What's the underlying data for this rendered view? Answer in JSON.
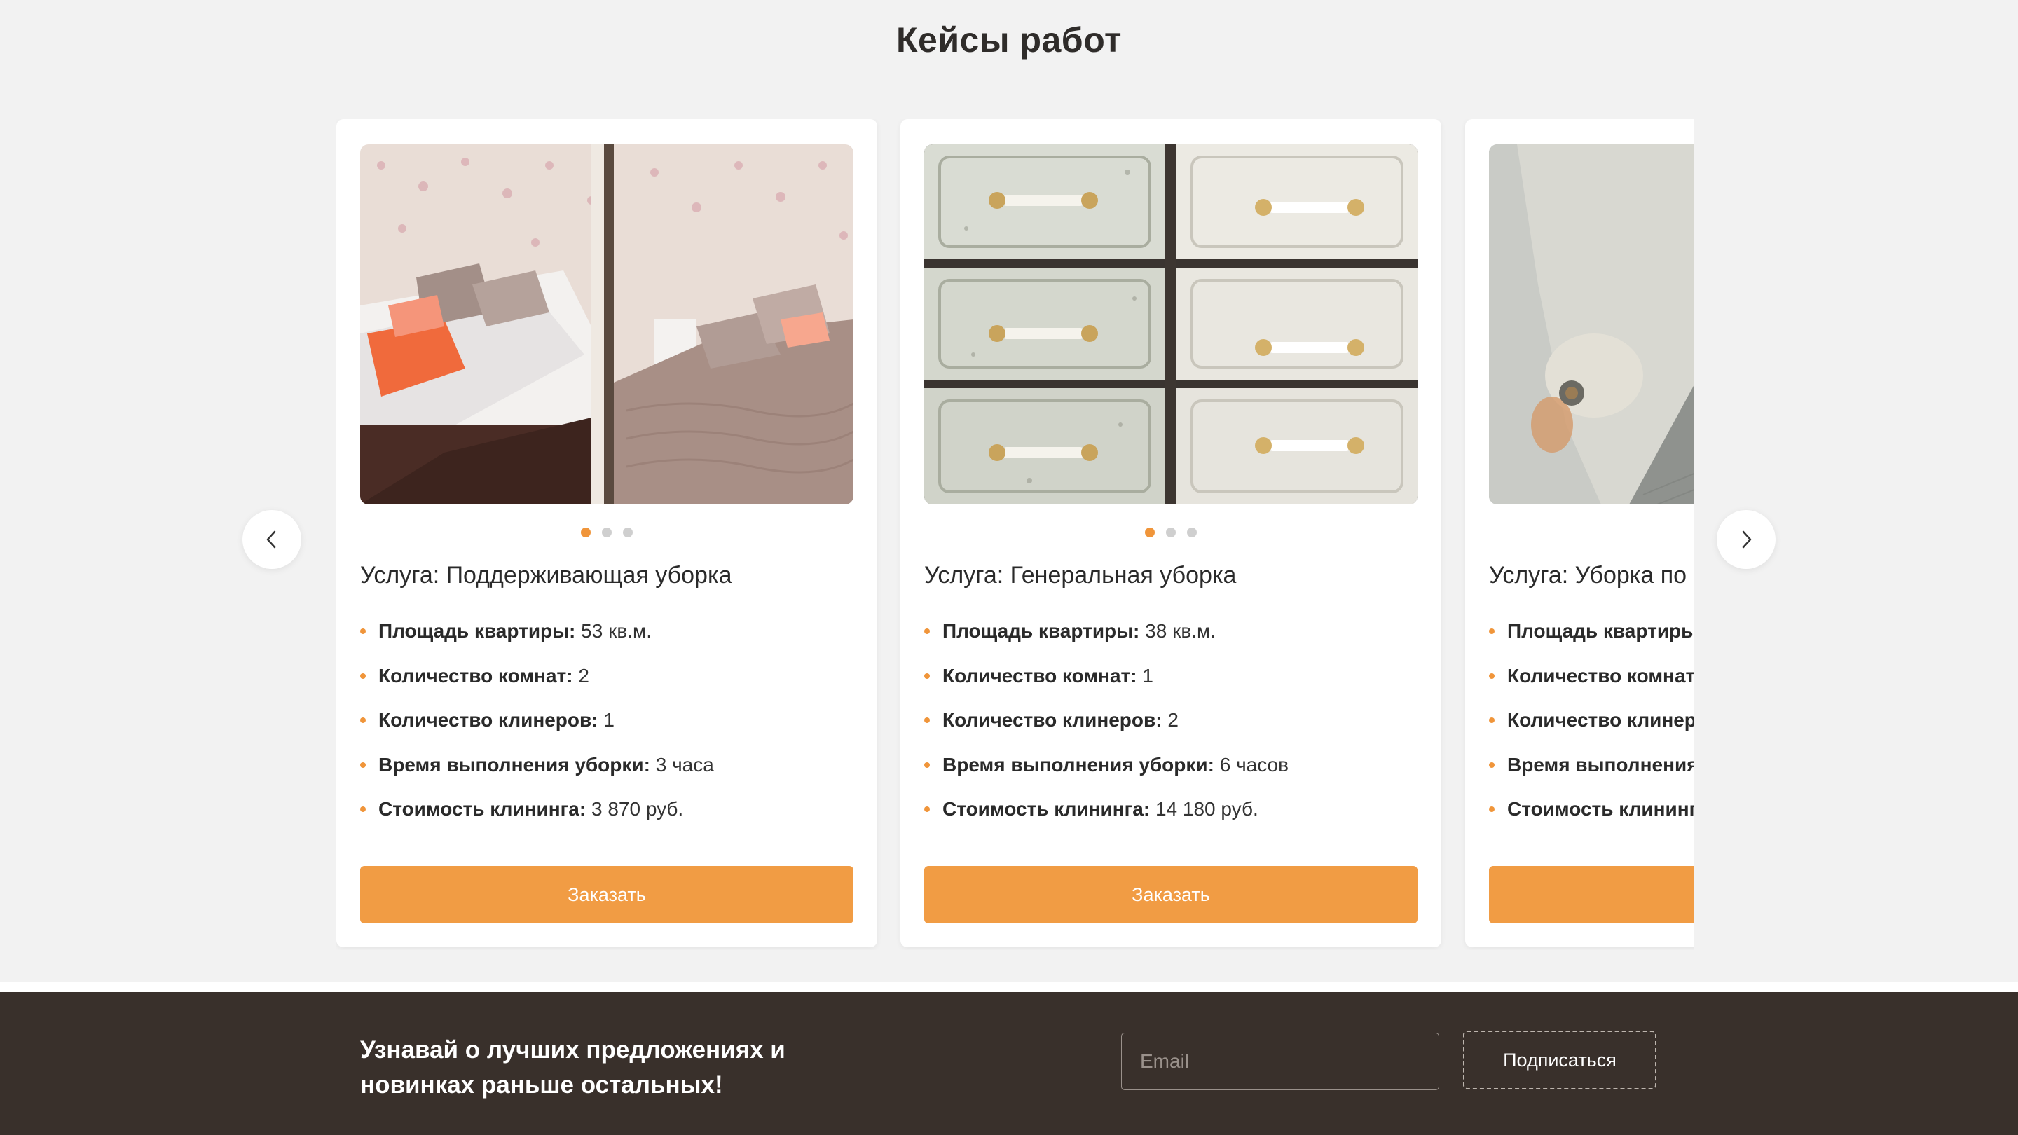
{
  "section": {
    "title": "Кейсы работ"
  },
  "cards": [
    {
      "title": "Услуга: Поддерживающая уборка",
      "specs": [
        {
          "label": "Площадь квартиры:",
          "value": " 53 кв.м."
        },
        {
          "label": "Количество комнат:",
          "value": " 2"
        },
        {
          "label": "Количество клинеров:",
          "value": " 1"
        },
        {
          "label": "Время выполнения уборки:",
          "value": " 3 часа"
        },
        {
          "label": "Стоимость клининга:",
          "value": " 3 870 руб."
        }
      ],
      "button": "Заказать",
      "image": "bedroom-before-after"
    },
    {
      "title": "Услуга: Генеральная уборка",
      "specs": [
        {
          "label": "Площадь квартиры:",
          "value": " 38 кв.м."
        },
        {
          "label": "Количество комнат:",
          "value": " 1"
        },
        {
          "label": "Количество клинеров:",
          "value": " 2"
        },
        {
          "label": "Время выполнения уборки:",
          "value": " 6 часов"
        },
        {
          "label": "Стоимость клининга:",
          "value": " 14 180 руб."
        }
      ],
      "button": "Заказать",
      "image": "drawers-before-after"
    },
    {
      "title": "Услуга: Уборка по",
      "specs": [
        {
          "label": "Площадь квартиры",
          "value": ""
        },
        {
          "label": "Количество комнат",
          "value": ""
        },
        {
          "label": "Количество клинер",
          "value": ""
        },
        {
          "label": "Время выполнения",
          "value": ""
        },
        {
          "label": "Стоимость клининг",
          "value": ""
        }
      ],
      "button": "",
      "image": "bathtub-before"
    }
  ],
  "carousel": {
    "prev_icon": "chevron-left-icon",
    "next_icon": "chevron-right-icon",
    "dots_total": 3,
    "active_dot": 0
  },
  "subscribe": {
    "text_line1": "Узнавай о лучших предложениях и",
    "text_line2": "новинках раньше остальных!",
    "email_placeholder": "Email",
    "button": "Подписаться"
  },
  "colors": {
    "accent": "#f19c44",
    "footer_bg": "#39302b",
    "page_bg": "#f2f2f2"
  }
}
